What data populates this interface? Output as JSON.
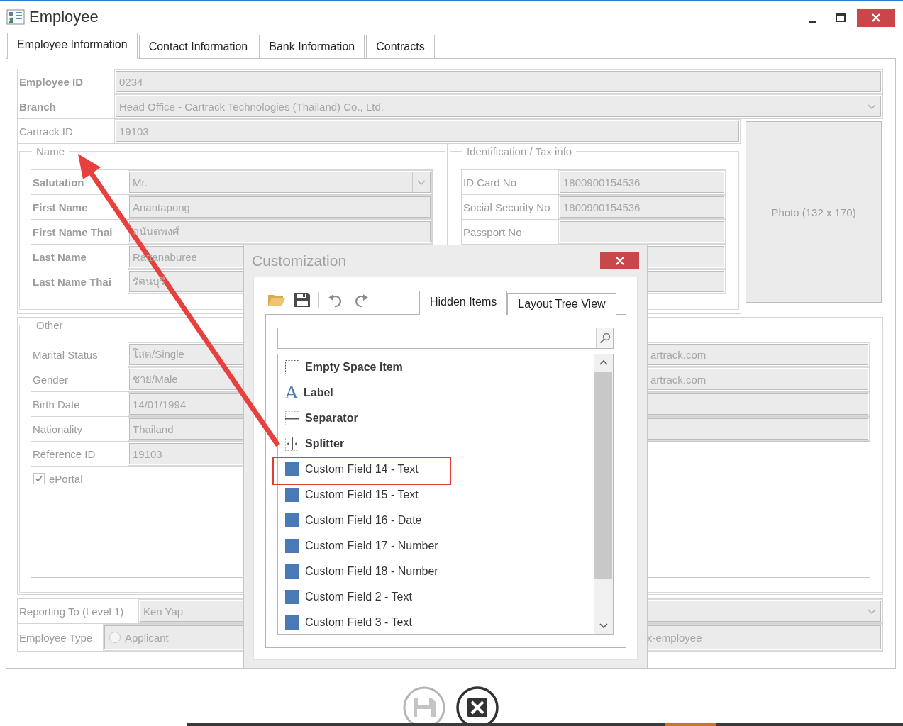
{
  "window": {
    "title": "Employee"
  },
  "tabs": [
    {
      "label": "Employee Information",
      "selected": true
    },
    {
      "label": "Contact Information",
      "selected": false
    },
    {
      "label": "Bank Information",
      "selected": false
    },
    {
      "label": "Contracts",
      "selected": false
    }
  ],
  "top_fields": [
    {
      "label": "Employee ID",
      "value": "0234",
      "bold": true,
      "kind": "text"
    },
    {
      "label": "Branch",
      "value": "Head Office - Cartrack Technologies (Thailand) Co., Ltd.",
      "bold": true,
      "kind": "dropdown"
    }
  ],
  "cartrack_field": {
    "label": "Cartrack ID",
    "value": "19103",
    "bold": false,
    "kind": "text"
  },
  "photo": {
    "label": "Photo (132 x 170)"
  },
  "name_group": {
    "title": "Name",
    "fields": [
      {
        "label": "Salutation",
        "value": "Mr.",
        "bold": true,
        "kind": "dropdown"
      },
      {
        "label": "First Name",
        "value": "Anantapong",
        "bold": true,
        "kind": "text"
      },
      {
        "label": "First Name Thai",
        "value": "อนันตพงศ์",
        "bold": true,
        "kind": "text"
      },
      {
        "label": "Last Name",
        "value": "Rattanaburee",
        "bold": true,
        "kind": "text"
      },
      {
        "label": "Last Name Thai",
        "value": "รัตนบุรี",
        "bold": true,
        "kind": "text"
      }
    ]
  },
  "id_group": {
    "title": "Identification / Tax info",
    "fields": [
      {
        "label": "ID Card No",
        "value": "1800900154536",
        "bold": false,
        "kind": "text"
      },
      {
        "label": "Social Security No",
        "value": "1800900154536",
        "bold": false,
        "kind": "text"
      },
      {
        "label": "Passport No",
        "bold": false,
        "kind": "text"
      },
      {
        "kind": "covered"
      },
      {
        "kind": "covered"
      }
    ]
  },
  "other_group": {
    "title": "Other",
    "left_fields": [
      {
        "label": "Marital Status",
        "value": "โสด/Single",
        "bold": false,
        "kind": "text"
      },
      {
        "label": "Gender",
        "value": "ชาย/Male",
        "bold": false,
        "kind": "text"
      },
      {
        "label": "Birth Date",
        "value": "14/01/1994",
        "bold": false,
        "kind": "text"
      },
      {
        "label": "Nationality",
        "value": "Thailand",
        "bold": false,
        "kind": "text"
      },
      {
        "label": "Reference ID",
        "value": "19103",
        "bold": false,
        "kind": "text"
      }
    ],
    "eportal": {
      "label": "ePortal",
      "checked": true
    },
    "right_fields": [
      {
        "kind": "text",
        "value": "artrack.com"
      },
      {
        "kind": "text",
        "value": "artrack.com"
      },
      {
        "kind": "blank"
      },
      {
        "kind": "blank"
      }
    ]
  },
  "reporting_to": {
    "label": "Reporting To (Level 1)",
    "value": "Ken Yap",
    "bold": false,
    "kind": "dropdown"
  },
  "employee_type": {
    "label": "Employee Type",
    "options": [
      {
        "label": "Applicant",
        "selected": false
      }
    ],
    "trailing_text": "x-employee"
  },
  "customization": {
    "title": "Customization",
    "tabs": [
      {
        "label": "Hidden Items",
        "selected": true
      },
      {
        "label": "Layout Tree View",
        "selected": false
      }
    ],
    "items": [
      {
        "label": "Empty Space Item",
        "kind": "empty-space",
        "highlighted": false
      },
      {
        "label": "Label",
        "kind": "label",
        "icon_text": "A",
        "highlighted": false
      },
      {
        "label": "Separator",
        "kind": "separator",
        "highlighted": false
      },
      {
        "label": "Splitter",
        "kind": "splitter",
        "highlighted": false
      },
      {
        "label": "Custom Field 14 - Text",
        "kind": "field",
        "highlighted": true
      },
      {
        "label": "Custom Field 15 - Text",
        "kind": "field",
        "highlighted": false
      },
      {
        "label": "Custom Field 16 - Date",
        "kind": "field",
        "highlighted": false
      },
      {
        "label": "Custom Field 17 - Number",
        "kind": "field",
        "highlighted": false
      },
      {
        "label": "Custom Field 18 - Number",
        "kind": "field",
        "highlighted": false
      },
      {
        "label": "Custom Field 2 - Text",
        "kind": "field",
        "highlighted": false
      },
      {
        "label": "Custom Field 3 - Text",
        "kind": "field",
        "highlighted": false
      }
    ]
  }
}
